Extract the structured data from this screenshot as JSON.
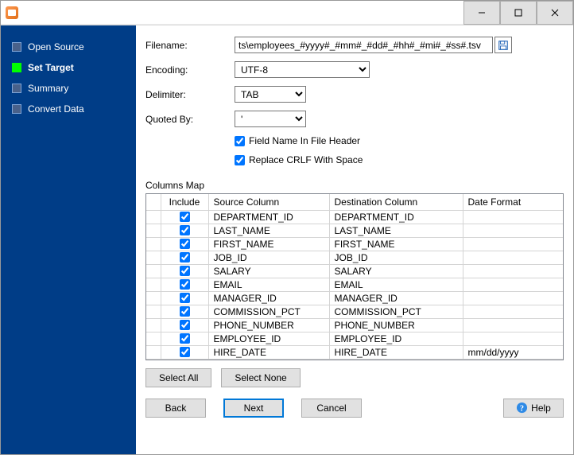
{
  "sidebar": {
    "items": [
      {
        "label": "Open Source",
        "active": false
      },
      {
        "label": "Set Target",
        "active": true
      },
      {
        "label": "Summary",
        "active": false
      },
      {
        "label": "Convert Data",
        "active": false
      }
    ]
  },
  "form": {
    "filename_label": "Filename:",
    "filename_value": "ts\\employees_#yyyy#_#mm#_#dd#_#hh#_#mi#_#ss#.tsv",
    "encoding_label": "Encoding:",
    "encoding_value": "UTF-8",
    "delimiter_label": "Delimiter:",
    "delimiter_value": "TAB",
    "quoted_by_label": "Quoted By:",
    "quoted_by_value": "'",
    "field_name_header_label": "Field Name In File Header",
    "replace_crlf_label": "Replace CRLF With Space"
  },
  "columns_map": {
    "title": "Columns Map",
    "headers": {
      "include": "Include",
      "source": "Source Column",
      "destination": "Destination Column",
      "dateformat": "Date Format"
    },
    "rows": [
      {
        "include": true,
        "source": "DEPARTMENT_ID",
        "destination": "DEPARTMENT_ID",
        "dateformat": ""
      },
      {
        "include": true,
        "source": "LAST_NAME",
        "destination": "LAST_NAME",
        "dateformat": ""
      },
      {
        "include": true,
        "source": "FIRST_NAME",
        "destination": "FIRST_NAME",
        "dateformat": ""
      },
      {
        "include": true,
        "source": "JOB_ID",
        "destination": "JOB_ID",
        "dateformat": ""
      },
      {
        "include": true,
        "source": "SALARY",
        "destination": "SALARY",
        "dateformat": ""
      },
      {
        "include": true,
        "source": "EMAIL",
        "destination": "EMAIL",
        "dateformat": ""
      },
      {
        "include": true,
        "source": "MANAGER_ID",
        "destination": "MANAGER_ID",
        "dateformat": ""
      },
      {
        "include": true,
        "source": "COMMISSION_PCT",
        "destination": "COMMISSION_PCT",
        "dateformat": ""
      },
      {
        "include": true,
        "source": "PHONE_NUMBER",
        "destination": "PHONE_NUMBER",
        "dateformat": ""
      },
      {
        "include": true,
        "source": "EMPLOYEE_ID",
        "destination": "EMPLOYEE_ID",
        "dateformat": ""
      },
      {
        "include": true,
        "source": "HIRE_DATE",
        "destination": "HIRE_DATE",
        "dateformat": "mm/dd/yyyy"
      }
    ]
  },
  "buttons": {
    "select_all": "Select All",
    "select_none": "Select None",
    "back": "Back",
    "next": "Next",
    "cancel": "Cancel",
    "help": "Help"
  }
}
